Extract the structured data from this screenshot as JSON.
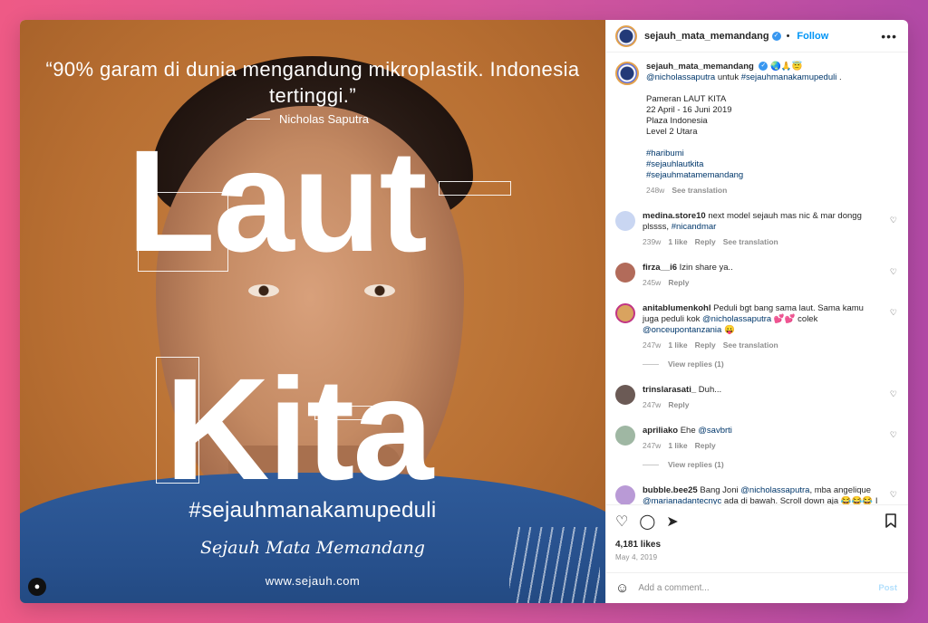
{
  "image": {
    "quote": "“90% garam di dunia mengandung mikroplastik. Indonesia tertinggi.”",
    "quote_author": "Nicholas Saputra",
    "word_laut": "Laut",
    "word_kita": "Kita",
    "hashtag": "#sejauhmanakamupeduli",
    "brand_signature": "Sejauh Mata Memandang",
    "brand_url": "www.sejauh.com"
  },
  "header": {
    "username": "sejauh_mata_memandang",
    "follow_label": "Follow",
    "more_label": "•••"
  },
  "caption": {
    "username": "sejauh_mata_memandang",
    "emojis": "🌏🙏😇",
    "mention": "@nicholassaputra",
    "text_mid": "untuk",
    "hashtag_main": "#sejauhmanakamupeduli",
    "event_title": "Pameran LAUT KITA",
    "event_dates": "22 April - 16 Juni 2019",
    "event_place": "Plaza Indonesia",
    "event_level": "Level 2 Utara",
    "tags": [
      "#haribumi",
      "#sejauhlautkita",
      "#sejauhmatamemandang"
    ],
    "time": "248w",
    "see_translation": "See translation"
  },
  "comments": [
    {
      "username": "medina.store10",
      "text": "next model sejauh mas nic & mar dongg plssss,",
      "tag": "#nicandmar",
      "time": "239w",
      "likes": "1 like",
      "reply": "Reply",
      "translation": "See translation",
      "avatar_color": "#c9d6f2"
    },
    {
      "username": "firza__i6",
      "text": "Izin share ya..",
      "time": "245w",
      "reply": "Reply",
      "avatar_color": "#b26b5a"
    },
    {
      "username": "anitablumenkohl",
      "text": "Peduli bgt bang sama laut. Sama kamu juga peduli kok",
      "mention1": "@nicholassaputra",
      "text2": "💕💕 colek",
      "mention2": "@onceupontanzania",
      "text3": "😛",
      "time": "247w",
      "likes": "1 like",
      "reply": "Reply",
      "translation": "See translation",
      "view_replies": "View replies (1)",
      "avatar_color": "#d9a35f"
    },
    {
      "username": "trinslarasati_",
      "text": "Duh...",
      "time": "247w",
      "reply": "Reply",
      "avatar_color": "#6b5a55"
    },
    {
      "username": "apriliako",
      "text": "Ehe",
      "mention": "@savbrti",
      "time": "247w",
      "likes": "1 like",
      "reply": "Reply",
      "view_replies": "View replies (1)",
      "avatar_color": "#9fb7a3"
    },
    {
      "username": "bubble.bee25",
      "text": "Bang Joni",
      "mention1": "@nicholassaputra",
      "text2": ", mba angelique",
      "mention2": "@marianadantecnyc",
      "text3": "ada di bawah. Scroll down aja 😂😂😂 I",
      "avatar_color": "#b99ad6"
    }
  ],
  "actions": {
    "likes": "4,181 likes",
    "date": "May 4, 2019"
  },
  "add_comment": {
    "placeholder": "Add a comment...",
    "post_label": "Post"
  },
  "colors": {
    "link": "#00376b",
    "follow": "#0095f6",
    "background_gradient": [
      "#ee5a86",
      "#b24aa6"
    ]
  }
}
